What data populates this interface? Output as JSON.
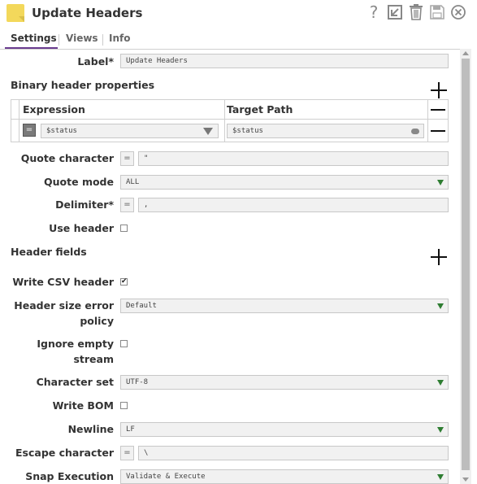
{
  "header": {
    "title": "Update Headers",
    "icons": [
      "help-icon",
      "export-icon",
      "delete-icon",
      "save-icon",
      "close-icon"
    ]
  },
  "tabs": [
    {
      "label": "Settings",
      "active": true
    },
    {
      "label": "Views",
      "active": false
    },
    {
      "label": "Info",
      "active": false
    }
  ],
  "form": {
    "label": {
      "label": "Label*",
      "value": "Update Headers"
    },
    "binary_header": {
      "title": "Binary header properties",
      "columns": [
        "Expression",
        "Target Path"
      ],
      "row": {
        "expression": "$status",
        "target_path": "$status",
        "expression_toggle": "="
      }
    },
    "quote_character": {
      "label": "Quote character",
      "value": "\"",
      "toggle": "="
    },
    "quote_mode": {
      "label": "Quote mode",
      "value": "ALL"
    },
    "delimiter": {
      "label": "Delimiter*",
      "value": ",",
      "toggle": "="
    },
    "use_header": {
      "label": "Use header",
      "checked": false
    },
    "header_fields": {
      "title": "Header fields"
    },
    "write_csv_header": {
      "label": "Write CSV header",
      "checked": true,
      "mark": "✔"
    },
    "header_size_error_policy": {
      "label1": "Header size error",
      "label2": "policy",
      "value": "Default"
    },
    "ignore_empty_stream": {
      "label1": "Ignore empty",
      "label2": "stream",
      "checked": false
    },
    "character_set": {
      "label": "Character set",
      "value": "UTF-8"
    },
    "write_bom": {
      "label": "Write BOM",
      "checked": false
    },
    "newline": {
      "label": "Newline",
      "value": "LF"
    },
    "escape_character": {
      "label": "Escape character",
      "value": "\\",
      "toggle": "="
    },
    "snap_execution": {
      "label": "Snap Execution",
      "value": "Validate & Execute"
    }
  },
  "colors": {
    "accent_tab": "#6a3c8f",
    "snap_icon": "#f3d85b",
    "select_caret": "#2e7d32"
  }
}
